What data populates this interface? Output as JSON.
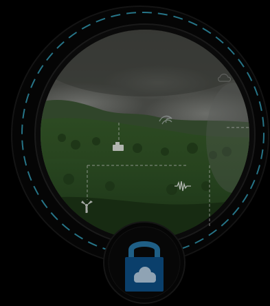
{
  "scene": {
    "description_icons": [
      "cloud-icon",
      "sensor-icon",
      "waveform-icon",
      "wind-turbine-icon",
      "wave-icon",
      "lock-icon"
    ],
    "colors": {
      "background": "#000000",
      "ring_dark": "#0d0d0d",
      "dashed_ring": "#2d8aa0",
      "lock_body": "#0a3f6b",
      "lock_shackle": "#1f5f86",
      "lock_cloud": "#8fa3b4",
      "overlay_line": "#b8b8b8"
    }
  },
  "lock": {
    "state": "locked"
  }
}
